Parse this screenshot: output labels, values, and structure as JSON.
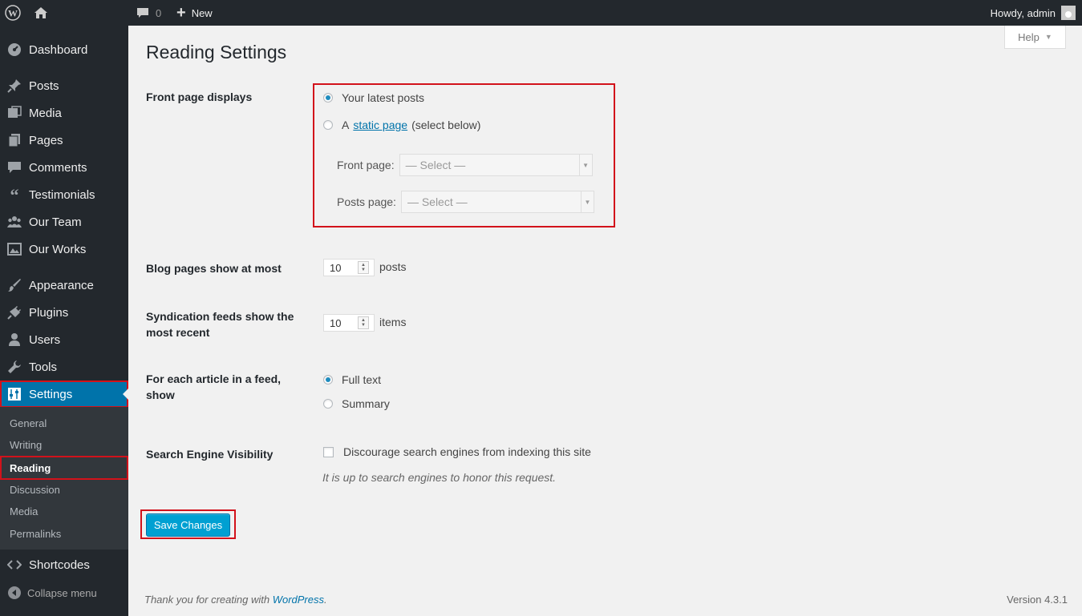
{
  "adminbar": {
    "comments_count": "0",
    "new_label": "New",
    "howdy": "Howdy, admin"
  },
  "sidebar": {
    "dashboard": "Dashboard",
    "posts": "Posts",
    "media": "Media",
    "pages": "Pages",
    "comments": "Comments",
    "testimonials": "Testimonials",
    "our_team": "Our Team",
    "our_works": "Our Works",
    "appearance": "Appearance",
    "plugins": "Plugins",
    "users": "Users",
    "tools": "Tools",
    "settings": "Settings",
    "shortcodes": "Shortcodes",
    "collapse": "Collapse menu",
    "submenu": {
      "general": "General",
      "writing": "Writing",
      "reading": "Reading",
      "discussion": "Discussion",
      "media": "Media",
      "permalinks": "Permalinks"
    }
  },
  "help": "Help",
  "page_title": "Reading Settings",
  "front_page": {
    "label": "Front page displays",
    "option_latest": "Your latest posts",
    "option_static_prefix": "A",
    "option_static_link": "static page",
    "option_static_suffix": "(select below)",
    "front_page_label": "Front page:",
    "front_page_value": "— Select —",
    "posts_page_label": "Posts page:",
    "posts_page_value": "— Select —"
  },
  "blog_pages": {
    "label": "Blog pages show at most",
    "value": "10",
    "unit": "posts"
  },
  "syndication": {
    "label": "Syndication feeds show the most recent",
    "value": "10",
    "unit": "items"
  },
  "feed_article": {
    "label": "For each article in a feed, show",
    "option_full": "Full text",
    "option_summary": "Summary"
  },
  "search_visibility": {
    "label": "Search Engine Visibility",
    "checkbox_label": "Discourage search engines from indexing this site",
    "description": "It is up to search engines to honor this request."
  },
  "save_button": "Save Changes",
  "footer": {
    "thanks_prefix": "Thank you for creating with",
    "thanks_link": "WordPress",
    "thanks_suffix": ".",
    "version": "Version 4.3.1"
  },
  "colors": {
    "sidebar_bg": "#23282d",
    "accent": "#0073aa",
    "highlight_border": "#d2121b",
    "button": "#00a0d2"
  }
}
